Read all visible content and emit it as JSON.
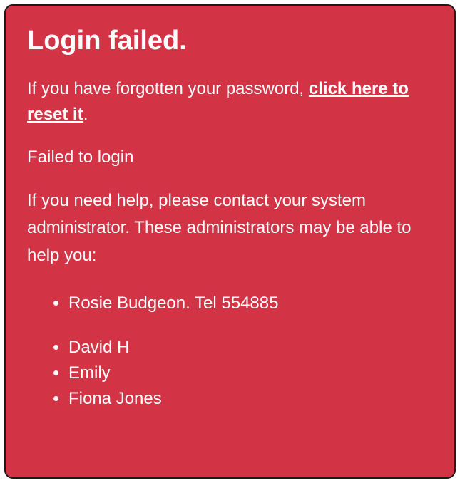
{
  "heading": "Login failed.",
  "forgot": {
    "prefix": "If you have forgotten your password, ",
    "link_text": "click here to reset it",
    "suffix": "."
  },
  "failure_message": "Failed to login",
  "help_text": "If you need help, please contact your system administrator. These administrators may be able to help you:",
  "admins": [
    "Rosie Budgeon. Tel 554885",
    "David H",
    "Emily",
    "Fiona Jones"
  ]
}
